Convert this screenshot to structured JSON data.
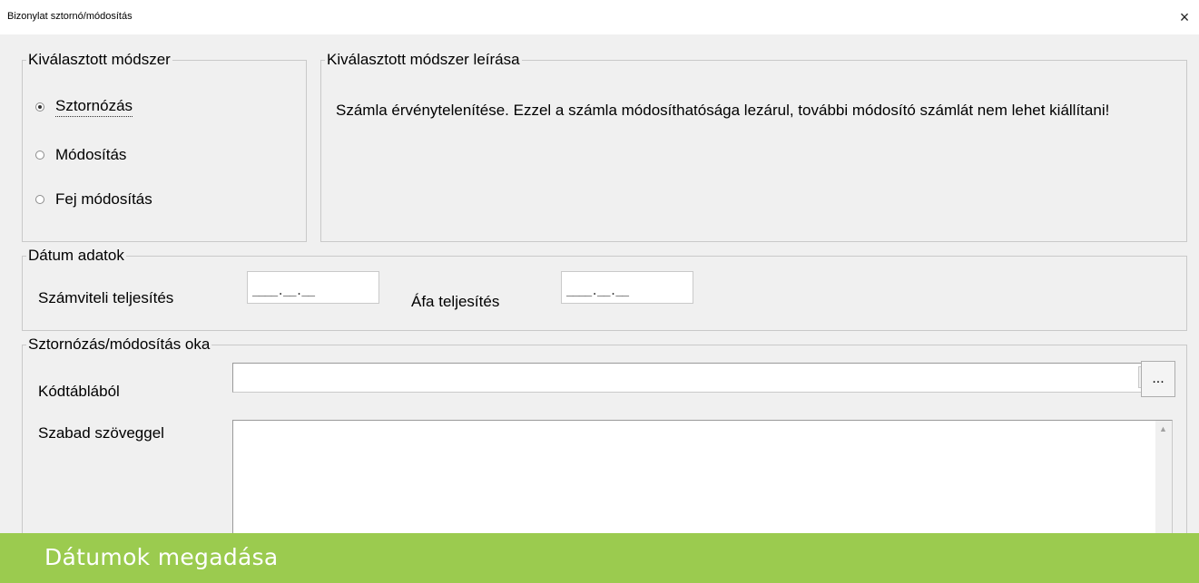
{
  "window": {
    "title": "Bizonylat sztornó/módosítás",
    "close_glyph": "×"
  },
  "method": {
    "legend": "Kiválasztott módszer",
    "options": [
      {
        "label": "Sztornózás",
        "selected": true
      },
      {
        "label": "Módosítás",
        "selected": false
      },
      {
        "label": "Fej módosítás",
        "selected": false
      }
    ]
  },
  "description": {
    "legend": "Kiválasztott módszer leírása",
    "text": "Számla érvénytelenítése. Ezzel a számla módosíthatósága lezárul, további módosító számlát nem lehet kiállítani!"
  },
  "dates": {
    "legend": "Dátum adatok",
    "accounting_label": "Számviteli teljesítés",
    "accounting_value": "____.__.__",
    "vat_label": "Áfa teljesítés",
    "vat_value": "____.__.__"
  },
  "reason": {
    "legend": "Sztornózás/módosítás oka",
    "code_label": "Kódtáblából",
    "code_value": "",
    "browse_label": "...",
    "free_text_label": "Szabad szöveggel",
    "free_text_value": ""
  },
  "banner": {
    "text": "Dátumok megadása",
    "color": "#9bcb4f"
  }
}
